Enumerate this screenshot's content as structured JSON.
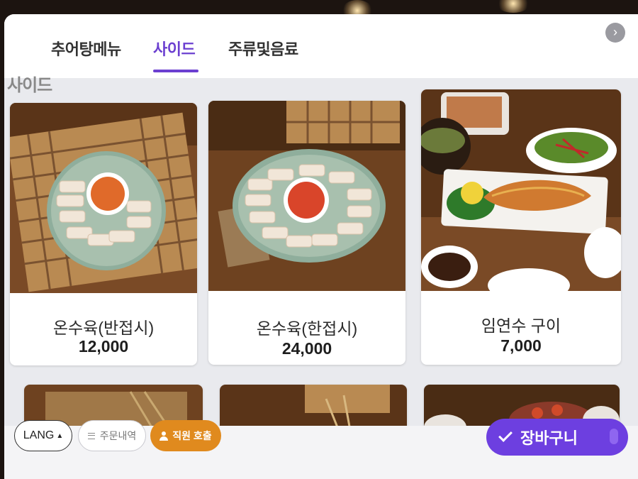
{
  "tabs": [
    {
      "label": "추어탕메뉴",
      "active": false
    },
    {
      "label": "사이드",
      "active": true
    },
    {
      "label": "주류및음료",
      "active": false
    }
  ],
  "section_title": "사이드",
  "nav": {
    "next_icon": "chevron-right-icon",
    "next_glyph": "›"
  },
  "menu_items": [
    {
      "name": "온수육(반접시)",
      "price": "12,000"
    },
    {
      "name": "온수육(한접시)",
      "price": "24,000"
    },
    {
      "name": "임연수 구이",
      "price": "7,000"
    }
  ],
  "bottom": {
    "lang_label": "LANG",
    "lang_caret": "▲",
    "orders_label": "주문내역",
    "orders_icon": "list-icon",
    "staff_label": "직원 호출",
    "staff_icon": "person-icon",
    "cart_label": "장바구니",
    "cart_icon": "check-icon"
  },
  "colors": {
    "accent": "#6b3fd0",
    "cart": "#6d3fe0",
    "staff": "#e08a1e"
  }
}
